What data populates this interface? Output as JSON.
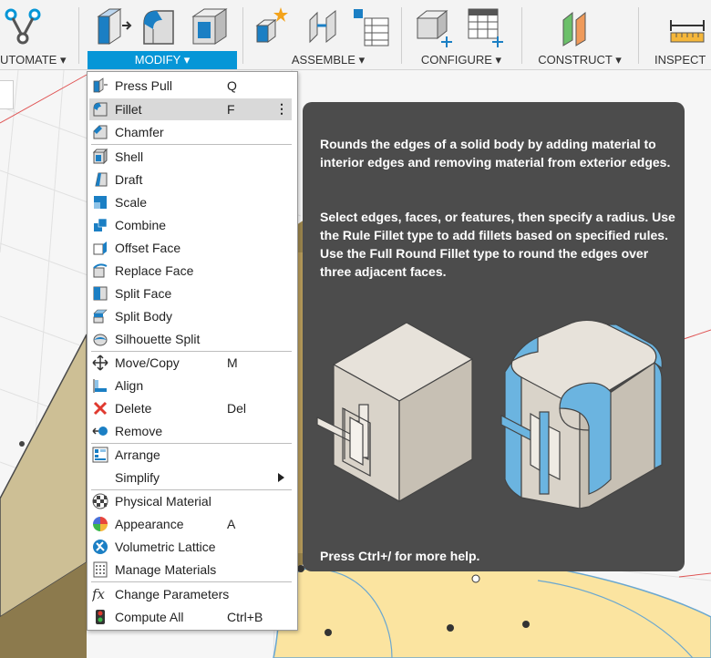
{
  "toolbar": {
    "groups": [
      {
        "label": "UTOMATE ▾"
      },
      {
        "label": "MODIFY ▾"
      },
      {
        "label": "ASSEMBLE ▾"
      },
      {
        "label": "CONFIGURE ▾"
      },
      {
        "label": "CONSTRUCT ▾"
      },
      {
        "label": "INSPECT"
      }
    ]
  },
  "menu": {
    "items": [
      {
        "label": "Press Pull",
        "shortcut": "Q",
        "icon": "press-pull-icon"
      },
      {
        "label": "Fillet",
        "shortcut": "F",
        "icon": "fillet-icon",
        "more": "⋮"
      },
      {
        "label": "Chamfer",
        "shortcut": "",
        "icon": "chamfer-icon"
      },
      {
        "label": "Shell",
        "shortcut": "",
        "icon": "shell-icon"
      },
      {
        "label": "Draft",
        "shortcut": "",
        "icon": "draft-icon"
      },
      {
        "label": "Scale",
        "shortcut": "",
        "icon": "scale-icon"
      },
      {
        "label": "Combine",
        "shortcut": "",
        "icon": "combine-icon"
      },
      {
        "label": "Offset Face",
        "shortcut": "",
        "icon": "offset-face-icon"
      },
      {
        "label": "Replace Face",
        "shortcut": "",
        "icon": "replace-face-icon"
      },
      {
        "label": "Split Face",
        "shortcut": "",
        "icon": "split-face-icon"
      },
      {
        "label": "Split Body",
        "shortcut": "",
        "icon": "split-body-icon"
      },
      {
        "label": "Silhouette Split",
        "shortcut": "",
        "icon": "silhouette-split-icon"
      },
      {
        "label": "Move/Copy",
        "shortcut": "M",
        "icon": "move-copy-icon"
      },
      {
        "label": "Align",
        "shortcut": "",
        "icon": "align-icon"
      },
      {
        "label": "Delete",
        "shortcut": "Del",
        "icon": "delete-icon"
      },
      {
        "label": "Remove",
        "shortcut": "",
        "icon": "remove-icon"
      },
      {
        "label": "Arrange",
        "shortcut": "",
        "icon": "arrange-icon"
      },
      {
        "label": "Simplify",
        "shortcut": "",
        "icon": "simplify-icon"
      },
      {
        "label": "Physical Material",
        "shortcut": "",
        "icon": "physical-material-icon"
      },
      {
        "label": "Appearance",
        "shortcut": "A",
        "icon": "appearance-icon"
      },
      {
        "label": "Volumetric Lattice",
        "shortcut": "",
        "icon": "volumetric-lattice-icon"
      },
      {
        "label": "Manage Materials",
        "shortcut": "",
        "icon": "manage-materials-icon"
      },
      {
        "label": "Change Parameters",
        "shortcut": "",
        "icon": "change-parameters-icon"
      },
      {
        "label": "Compute All",
        "shortcut": "Ctrl+B",
        "icon": "compute-all-icon"
      }
    ]
  },
  "tooltip": {
    "para1": "Rounds the edges of a solid body by adding material to interior edges and removing material from exterior edges.",
    "para2": "Select edges, faces, or features, then specify a radius. Use the Rule Fillet type to add fillets based on specified rules. Use the Full Round Fillet type to round the edges over three adjacent faces.",
    "footer": "Press Ctrl+/ for more help."
  },
  "colors": {
    "accent": "#0696d7",
    "tooltip_bg": "#4c4c4c",
    "highlight": "#d9d9d9",
    "fillet_blue": "#6bb4e0"
  }
}
